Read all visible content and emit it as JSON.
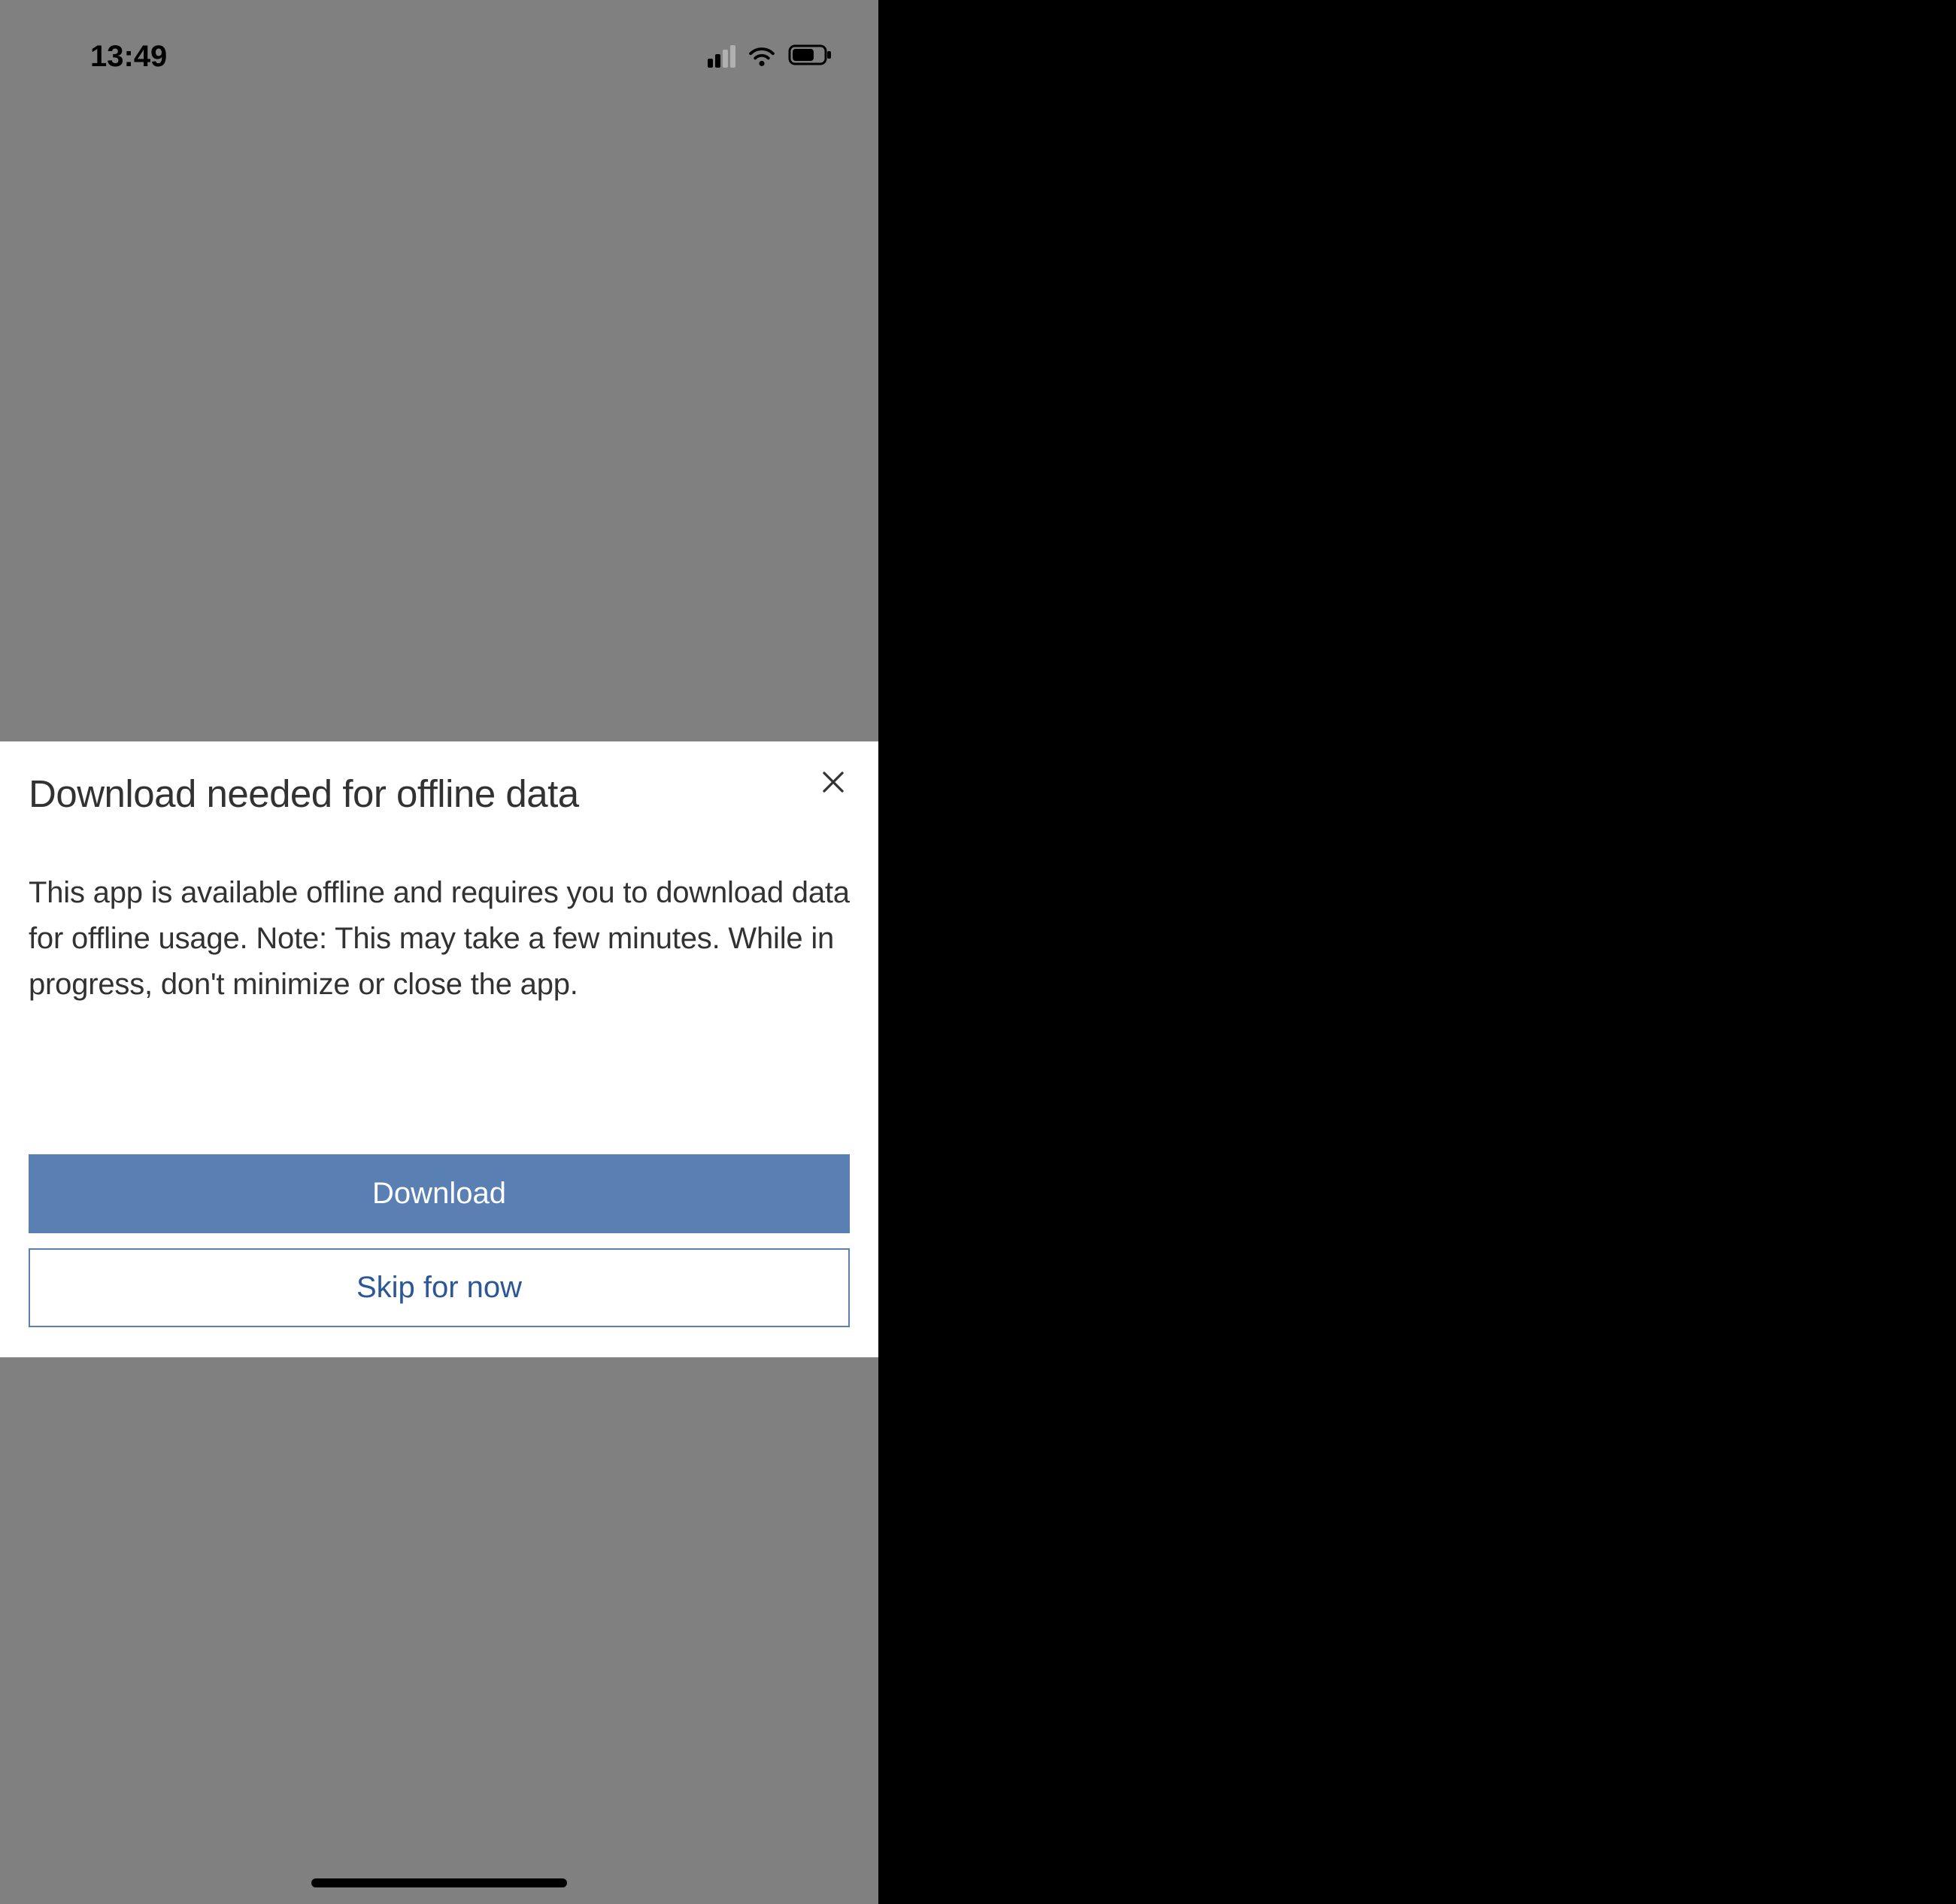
{
  "statusBar": {
    "time": "13:49"
  },
  "dialog": {
    "title": "Download needed for offline data",
    "body": "This app is available offline and requires you to download data for offline usage. Note: This may take a few minutes. While in progress, don't minimize or close the app.",
    "primaryButton": "Download",
    "secondaryButton": "Skip for now"
  }
}
